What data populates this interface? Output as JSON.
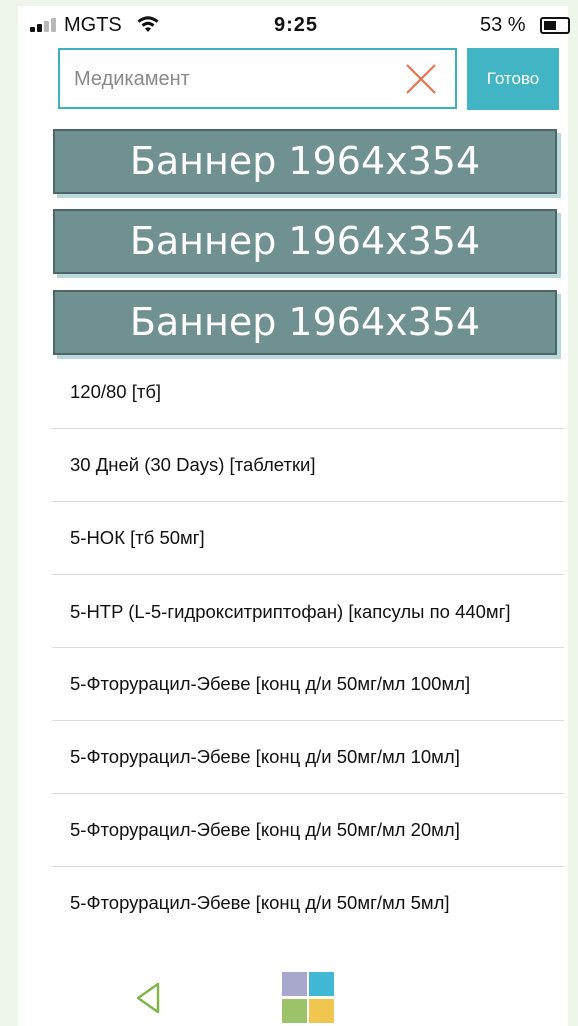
{
  "status_bar": {
    "carrier": "MGTS",
    "time": "9:25",
    "battery_percent": "53 %",
    "battery_level": 0.53
  },
  "search": {
    "placeholder": "Медикамент",
    "value": "",
    "done_label": "Готово",
    "accent_color": "#41b5c3"
  },
  "banners": [
    {
      "label": "Баннер 1964x354"
    },
    {
      "label": "Баннер 1964x354"
    },
    {
      "label": "Баннер 1964x354"
    }
  ],
  "medications": [
    "120/80 [тб]",
    "30 Дней (30 Days) [таблетки]",
    "5-НОК [тб 50мг]",
    "5-HTP (L-5-гидрокситриптофан) [капсулы по 440мг]",
    "5-Фторурацил-Эбеве [конц д/и 50мг/мл 100мл]",
    "5-Фторурацил-Эбеве [конц д/и 50мг/мл 10мл]",
    "5-Фторурацил-Эбеве [конц д/и 50мг/мл 20мл]",
    "5-Фторурацил-Эбеве [конц д/и 50мг/мл 5мл]"
  ],
  "nav": {
    "back_icon": "back-triangle-icon",
    "home_icon": "tiles-home-icon"
  }
}
